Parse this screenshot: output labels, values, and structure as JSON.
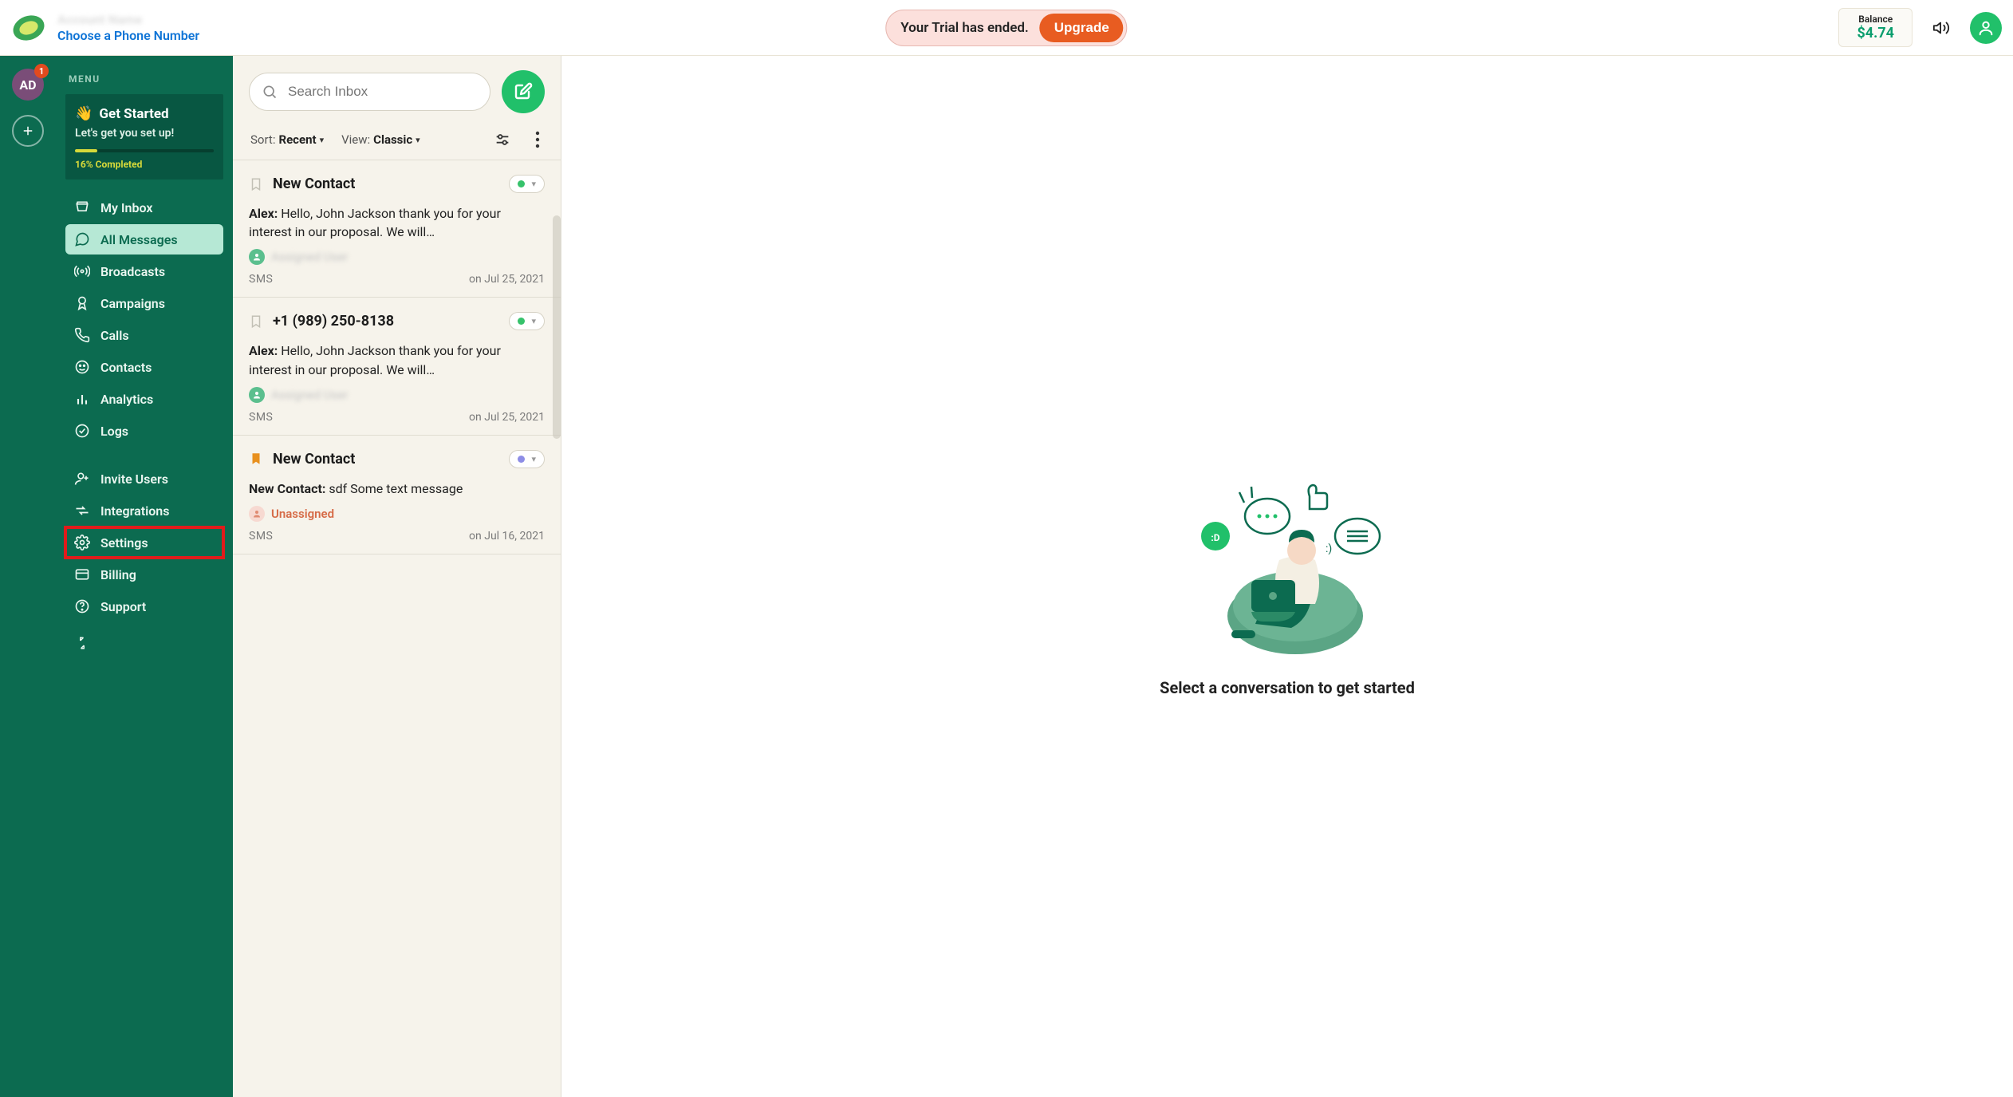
{
  "header": {
    "account_name": "Account Name",
    "phone_cta": "Choose a Phone Number",
    "trial_message": "Your Trial has ended.",
    "upgrade_label": "Upgrade",
    "balance_label": "Balance",
    "balance_amount": "$4.74"
  },
  "rail": {
    "avatar_initials": "AD",
    "avatar_badge": "1"
  },
  "sidebar": {
    "menu_title": "MENU",
    "get_started": {
      "title": "Get Started",
      "subtitle": "Let's get you set up!",
      "percent_label": "16% Completed",
      "percent": 16
    },
    "items": [
      {
        "id": "my-inbox",
        "label": "My Inbox",
        "icon": "inbox"
      },
      {
        "id": "all-messages",
        "label": "All Messages",
        "icon": "chat",
        "active": true
      },
      {
        "id": "broadcasts",
        "label": "Broadcasts",
        "icon": "broadcast"
      },
      {
        "id": "campaigns",
        "label": "Campaigns",
        "icon": "ribbon"
      },
      {
        "id": "calls",
        "label": "Calls",
        "icon": "phone"
      },
      {
        "id": "contacts",
        "label": "Contacts",
        "icon": "face"
      },
      {
        "id": "analytics",
        "label": "Analytics",
        "icon": "bars"
      },
      {
        "id": "logs",
        "label": "Logs",
        "icon": "check-circle"
      }
    ],
    "items2": [
      {
        "id": "invite-users",
        "label": "Invite Users",
        "icon": "user-plus"
      },
      {
        "id": "integrations",
        "label": "Integrations",
        "icon": "arrows"
      },
      {
        "id": "settings",
        "label": "Settings",
        "icon": "gear",
        "highlighted": true
      },
      {
        "id": "billing",
        "label": "Billing",
        "icon": "card"
      },
      {
        "id": "support",
        "label": "Support",
        "icon": "help"
      }
    ]
  },
  "inbox": {
    "search_placeholder": "Search Inbox",
    "sort_label": "Sort:",
    "sort_value": "Recent",
    "view_label": "View:",
    "view_value": "Classic",
    "threads": [
      {
        "name": "New Contact",
        "bookmark": false,
        "status": "green",
        "from": "Alex:",
        "preview": "Hello, John Jackson thank you for your interest in our proposal. We will…",
        "assignee": "Assigned User",
        "assignee_type": "user",
        "channel": "SMS",
        "date": "on Jul 25, 2021"
      },
      {
        "name": "+1 (989) 250-8138",
        "bookmark": false,
        "status": "green",
        "from": "Alex:",
        "preview": "Hello, John Jackson thank you for your interest in our proposal. We will…",
        "assignee": "Assigned User",
        "assignee_type": "user",
        "channel": "SMS",
        "date": "on Jul 25, 2021"
      },
      {
        "name": "New Contact",
        "bookmark": true,
        "status": "purple",
        "from": "New Contact:",
        "preview": "sdf Some text message",
        "assignee": "Unassigned",
        "assignee_type": "unassigned",
        "channel": "SMS",
        "date": "on Jul 16, 2021"
      }
    ]
  },
  "content": {
    "prompt": "Select a conversation to get started"
  }
}
